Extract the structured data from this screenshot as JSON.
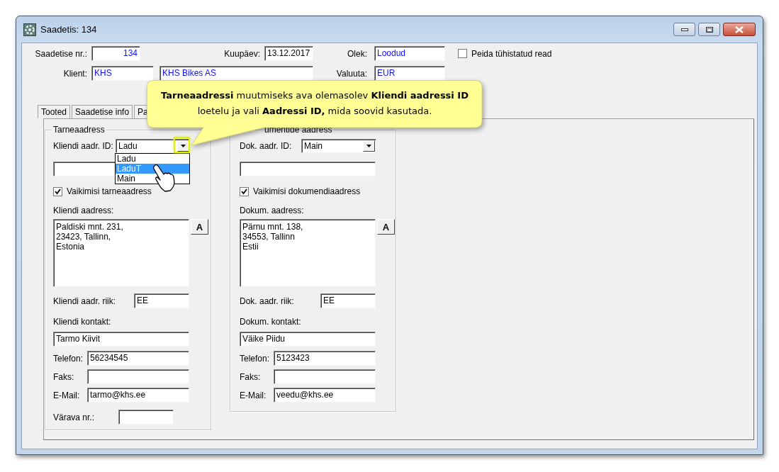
{
  "window": {
    "title": "Saadetis: 134"
  },
  "header": {
    "number": {
      "label": "Saadetise nr.:",
      "value": "134",
      "lookup": true
    },
    "date": {
      "label": "Kuupäev:",
      "value": "13.12.2017",
      "lookup": false
    },
    "status": {
      "label": "Olek:",
      "value": "Loodud",
      "lookup": true
    },
    "hide_cancelled": {
      "label": "Peida tühistatud read",
      "checked": false
    },
    "client": {
      "label": "Klient:",
      "code": "KHS",
      "name": "KHS Bikes AS",
      "lookup": true
    },
    "currency": {
      "label": "Valuuta:",
      "value": "EUR",
      "lookup": true
    }
  },
  "tabs": [
    {
      "label": "Tooted",
      "selected": false
    },
    {
      "label": "Saadetise info",
      "selected": false
    },
    {
      "label": "Pa",
      "selected": false
    }
  ],
  "groups": [
    {
      "legend": "Tarneaadress",
      "id_label": "Kliendi aadr. ID:",
      "id_value": "Ladu",
      "options": [
        {
          "label": "Ladu",
          "selected": false
        },
        {
          "label": "LaduT",
          "selected": true
        },
        {
          "label": "Main",
          "selected": false
        }
      ],
      "default": {
        "label": "Vaikimisi tarneaadress",
        "checked": true
      },
      "address_label": "Kliendi aadress:",
      "address_lines": [
        "Paldiski mnt. 231,",
        "23423, Tallinn,",
        "Estonia"
      ],
      "format_button": "A",
      "country_label": "Kliendi aadr. riik:",
      "country_value": "EE",
      "contact_label": "Kliendi kontakt:",
      "contact_value": "Tarmo Kiivit",
      "phone_label": "Telefon:",
      "phone_value": "56234545",
      "fax_label": "Faks:",
      "email_label": "E-Mail:",
      "email_value": "tarmo@khs.ee",
      "gate_label": "Värava nr.:"
    },
    {
      "legend": "umentide aadress",
      "id_label": "Dok. aadr. ID:",
      "id_value": "Main",
      "default": {
        "label": "Vaikimisi dokumendiaadress",
        "checked": true
      },
      "address_label": "Dokum. aadress:",
      "address_lines": [
        "Pärnu mnt. 138,",
        "34553, Tallinn",
        "Estii"
      ],
      "format_button": "A",
      "country_label": "Dok. aadr. riik:",
      "country_value": "EE",
      "contact_label": "Dokum. kontakt:",
      "contact_value": "Väike Piidu",
      "phone_label": "Telefon:",
      "phone_value": "5123423",
      "fax_label": "Faks:",
      "email_label": "E-Mail:",
      "email_value": "veedu@khs.ee"
    }
  ],
  "callout": {
    "lines": [
      "**Tarneaadressi** muutmiseks ava olemasolev **Kliendi aadressi ID**",
      "loetelu ja vali **Aadressi ID,** mida soovid kasutada."
    ]
  }
}
